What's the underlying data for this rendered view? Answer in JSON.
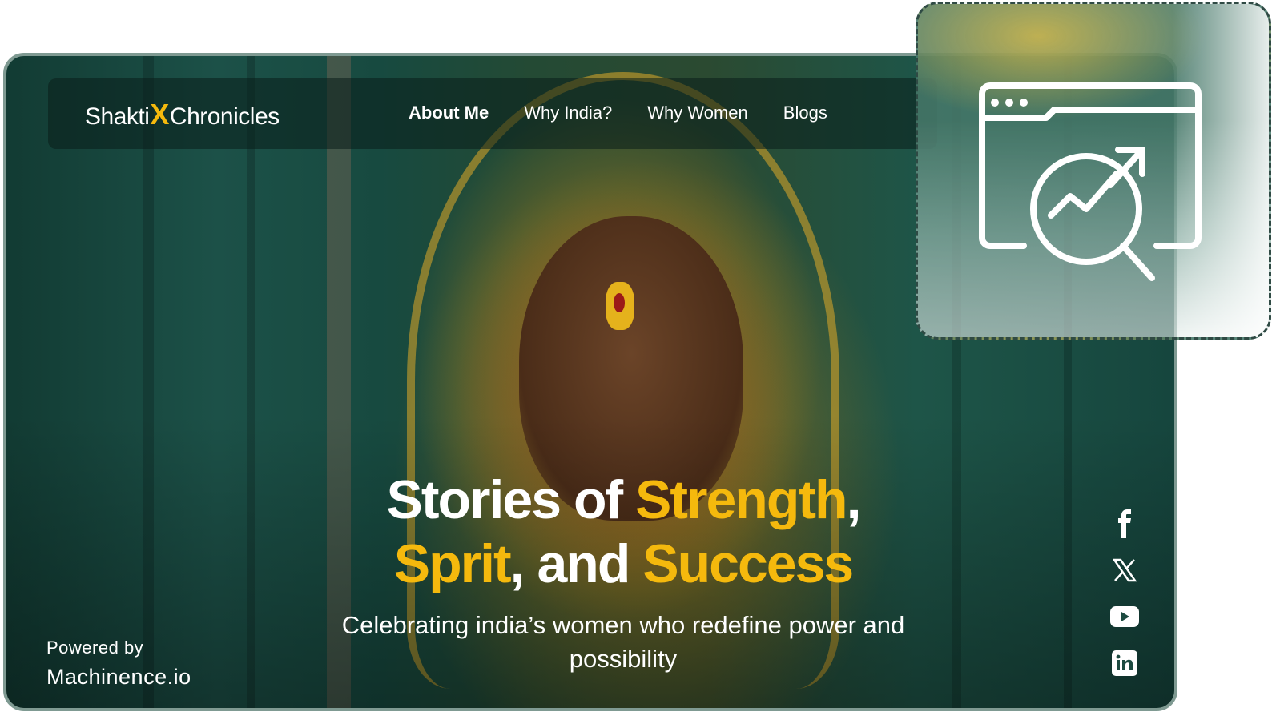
{
  "brand": {
    "name_left": "Shakti",
    "name_x": "X",
    "name_right": "Chronicles"
  },
  "nav": {
    "items": [
      {
        "label": "About Me",
        "active": true
      },
      {
        "label": "Why India?",
        "active": false
      },
      {
        "label": "Why Women",
        "active": false
      },
      {
        "label": "Blogs",
        "active": false
      }
    ]
  },
  "hero": {
    "title_line1_white": "Stories of ",
    "title_line1_accent": "Strength",
    "title_line1_end": ",",
    "title_line2_accent1": "Sprit",
    "title_line2_white": ", and ",
    "title_line2_accent2": "Success",
    "subtitle": "Celebrating india’s women who redefine power and possibility"
  },
  "footer": {
    "powered_label": "Powered by",
    "powered_brand": "Machinence.io"
  },
  "social": [
    {
      "icon": "facebook-icon"
    },
    {
      "icon": "x-twitter-icon"
    },
    {
      "icon": "youtube-icon"
    },
    {
      "icon": "linkedin-icon"
    }
  ],
  "float_panel": {
    "icon": "browser-analytics-search-icon"
  },
  "colors": {
    "accent": "#f5b90d",
    "background_green": "#1c5148",
    "text": "#ffffff"
  }
}
